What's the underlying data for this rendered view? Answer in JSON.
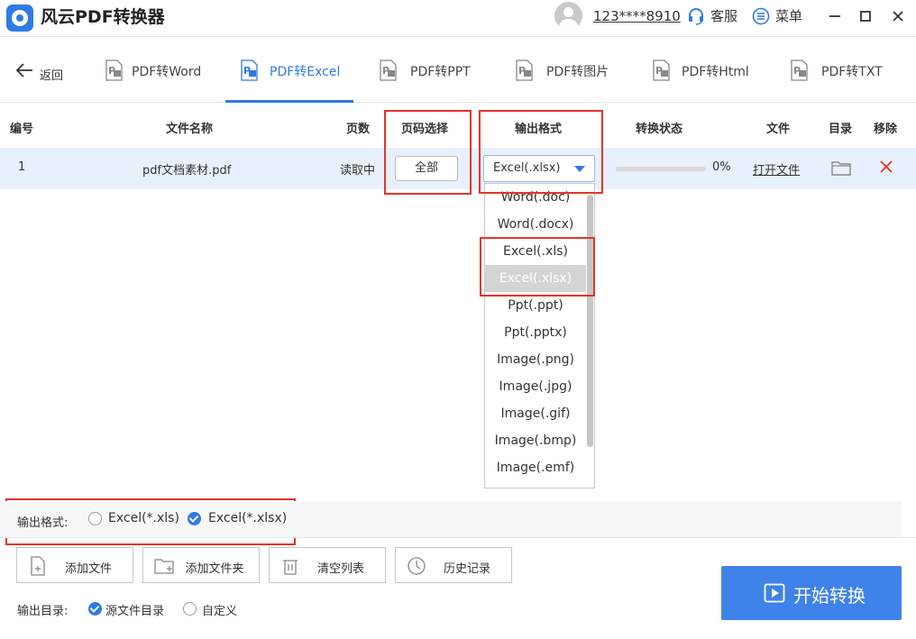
{
  "app": {
    "title": "风云PDF转换器",
    "username": "123****8910",
    "service_label": "客服",
    "menu_label": "菜单"
  },
  "nav": {
    "back_label": "返回",
    "tabs": [
      {
        "label": "PDF转Word",
        "active": false
      },
      {
        "label": "PDF转Excel",
        "active": true
      },
      {
        "label": "PDF转PPT",
        "active": false
      },
      {
        "label": "PDF转图片",
        "active": false
      },
      {
        "label": "PDF转Html",
        "active": false
      },
      {
        "label": "PDF转TXT",
        "active": false
      }
    ]
  },
  "table": {
    "headers": {
      "index": "编号",
      "filename": "文件名称",
      "pages": "页数",
      "page_select": "页码选择",
      "output_format": "输出格式",
      "status": "转换状态",
      "file": "文件",
      "directory": "目录",
      "remove": "移除"
    },
    "rows": [
      {
        "index": "1",
        "filename": "pdf文档素材.pdf",
        "pages": "读取中",
        "page_select": "全部",
        "output_format": "Excel(.xlsx)",
        "progress": 0,
        "progress_text": "0%",
        "open_file": "打开文件"
      }
    ]
  },
  "format_dropdown": {
    "options": [
      "Word(.doc)",
      "Word(.docx)",
      "Excel(.xls)",
      "Excel(.xlsx)",
      "Ppt(.ppt)",
      "Ppt(.pptx)",
      "Image(.png)",
      "Image(.jpg)",
      "Image(.gif)",
      "Image(.bmp)",
      "Image(.emf)"
    ],
    "selected": "Excel(.xlsx)"
  },
  "bottom": {
    "output_format_label": "输出格式:",
    "format_options": [
      {
        "label": "Excel(*.xls)",
        "checked": false
      },
      {
        "label": "Excel(*.xlsx)",
        "checked": true
      }
    ],
    "actions": {
      "add_file": "添加文件",
      "add_folder": "添加文件夹",
      "clear_list": "清空列表",
      "history": "历史记录"
    },
    "output_dir_label": "输出目录:",
    "dir_options": [
      {
        "label": "源文件目录",
        "checked": true
      },
      {
        "label": "自定义",
        "checked": false
      }
    ],
    "start_label": "开始转换"
  },
  "colors": {
    "accent": "#2f7be5",
    "start_button": "#3f82ea",
    "highlight": "#e6332a",
    "row_selected": "#e8f0fc",
    "remove": "#e6332a"
  },
  "icons": {
    "logo": "app-logo-icon",
    "service": "headset-icon",
    "menu": "menu-list-icon",
    "tab": "pdf-file-icon",
    "folder": "folder-icon",
    "remove": "close-x-icon",
    "start": "play-icon"
  }
}
